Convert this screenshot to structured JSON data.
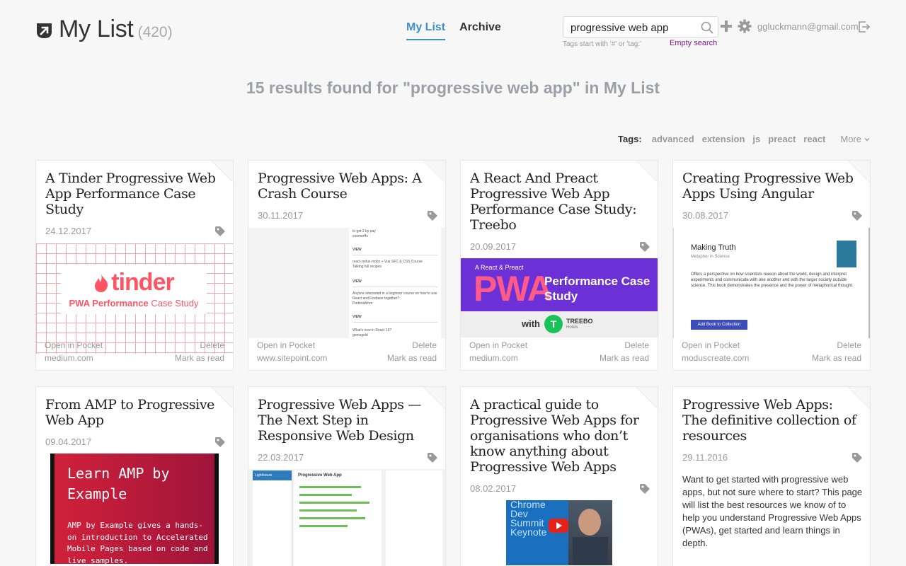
{
  "header": {
    "title": "My List",
    "count": "(420)",
    "tabs": [
      {
        "label": "My List",
        "active": true
      },
      {
        "label": "Archive",
        "active": false
      }
    ],
    "search": {
      "value": "progressive web app",
      "hint": "Tags start with '#' or 'tag:'",
      "empty_label": "Empty search"
    },
    "user_email": "ggluckmann@gmail.com"
  },
  "results_text": "15 results found for \"progressive web app\" in My List",
  "tags": {
    "label": "Tags:",
    "items": [
      "advanced",
      "extension",
      "js",
      "preact",
      "react"
    ],
    "more_label": "More"
  },
  "colors": {
    "accent": "#3f8fce",
    "empty_search": "#7c1d85",
    "tinder": "#fd5564",
    "pwa_purple": "#6c31d6",
    "amp_red": "#e0243c"
  },
  "card_actions": {
    "open": "Open in Pocket",
    "delete": "Delete",
    "archive": "Mark as read"
  },
  "cards": [
    {
      "title": "A Tinder Progressive Web App Performance Case Study",
      "date": "24.12.2017",
      "source": "medium.com",
      "thumb": {
        "brand": "tinder",
        "caption": "PWA Performance Case Study",
        "caption_strong": "PWA Performance",
        "caption_rest": " Case Study"
      }
    },
    {
      "title": "Progressive Web Apps: A Crash Course",
      "date": "30.11.2017",
      "source": "www.sitepoint.com",
      "thumb": {
        "lines": [
          "to get 2 by pay",
          "zoomerffs",
          "VIEW",
          "react-redux-mobx + Vue SFC & CSS Course",
          "Talking full recipes",
          "VIEW",
          "Anyone interested in a beginner course on how to use React and Firebase together?",
          "PurtiotaMnm",
          "VIEW",
          "What's new in React 16?",
          "gemsgold"
        ]
      }
    },
    {
      "title": "A React And Preact Progressive Web App Performance Case Study: Treebo",
      "date": "20.09.2017",
      "source": "medium.com",
      "thumb": {
        "kicker": "A React & Preact",
        "big": "PWA",
        "headline": "Performance Case Study",
        "with": "with",
        "brand": "TREEBO",
        "brand_sub": "Hotels"
      }
    },
    {
      "title": "Creating Progressive Web Apps Using Angular",
      "date": "30.08.2017",
      "source": "moduscreate.com",
      "thumb": {
        "book_title": "Making Truth",
        "book_sub": "Metaphor in Science",
        "book_text": "Offers a perspective on how scientists reason about the world, design and interpret experiments and communicate with one another and with the larger society outside science. This book demonstrates the presence and the power of metaphorical thought.",
        "button": "Add Book to Collection"
      }
    },
    {
      "title": "From AMP to Progressive Web App",
      "date": "09.04.2017",
      "source": "",
      "thumb": {
        "heading": "Learn AMP by Example",
        "body": "AMP by Example gives a hands-on introduction to Accelerated Mobile Pages based on code and live samples."
      }
    },
    {
      "title": "Progressive Web Apps — The Next Step in Responsive Web Design",
      "date": "22.03.2017",
      "source": "",
      "thumb": {
        "app_title": "Progressive Web App",
        "brand": "Lighthouse"
      }
    },
    {
      "title": "A practical guide to Progressive Web Apps for organisations who don’t know anything about Progressive Web Apps",
      "date": "08.02.2017",
      "source": "",
      "thumb": {
        "lines": [
          "Chrome",
          "Dev",
          "Summit",
          "Keynote"
        ]
      }
    },
    {
      "title": "Progressive Web Apps: The definitive collection of resources",
      "date": "29.11.2016",
      "source": "",
      "excerpt": "Want to get started with progressive web apps, but not sure where to start? This page will list the best resources we know of to help you understand Progressive Web Apps (PWAs), get started and learn things in depth."
    }
  ]
}
